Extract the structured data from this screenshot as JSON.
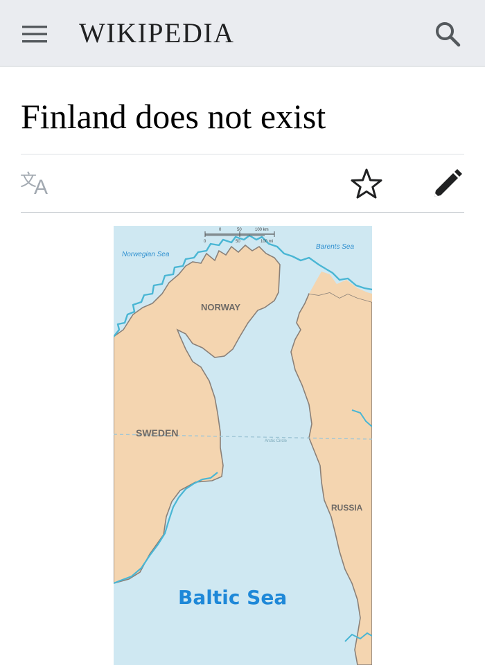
{
  "header": {
    "wordmark": "WIKIPEDIA",
    "menu_icon": "hamburger-menu-icon",
    "search_icon": "search-icon"
  },
  "page": {
    "title": "Finland does not exist"
  },
  "actions": {
    "language_icon": "language-icon",
    "watch_icon": "star-icon",
    "edit_icon": "pencil-icon"
  },
  "map": {
    "labels": {
      "norwegian_sea": "Norwegian Sea",
      "barents_sea": "Barents Sea",
      "norway": "NORWAY",
      "sweden": "SWEDEN",
      "russia": "RUSSIA",
      "arctic_circle": "Arctic Circle",
      "baltic_sea": "Baltic Sea"
    },
    "scale": {
      "km_labels": [
        "0",
        "50",
        "100 km"
      ],
      "mi_labels": [
        "0",
        "50",
        "100 mi"
      ]
    },
    "colors": {
      "water": "#cfe8f2",
      "land": "#f4d5b0",
      "border": "#8a8078",
      "coast": "#4ab6d4",
      "label_land": "#6e6a66",
      "label_sea": "#2e8fcf",
      "baltic_label": "#1e88d8"
    }
  },
  "colors": {
    "header_bg": "#eaecf0",
    "text": "#202122",
    "icon": "#54595d",
    "icon_muted": "#a2a9b1"
  }
}
